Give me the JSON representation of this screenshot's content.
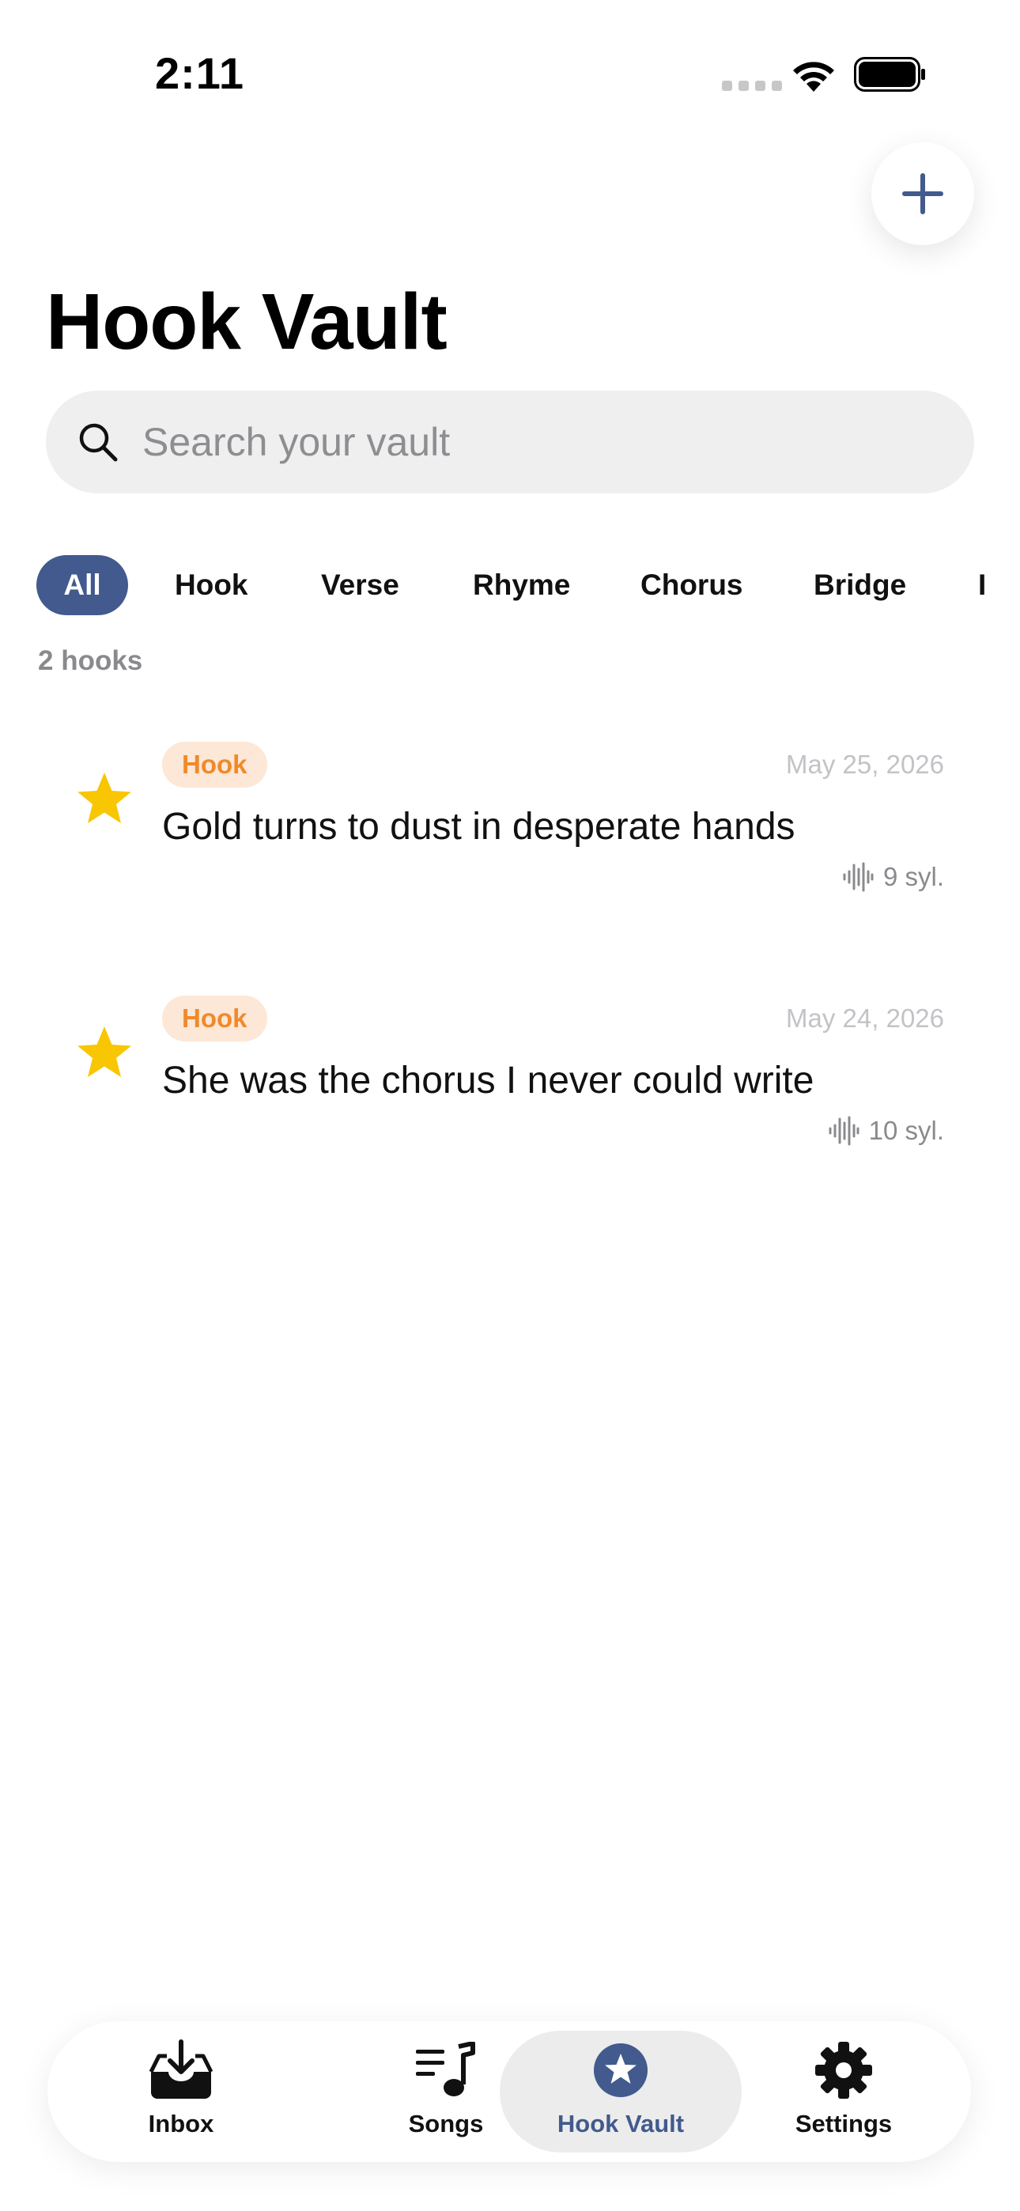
{
  "status_bar": {
    "time": "2:11"
  },
  "header": {
    "title": "Hook Vault",
    "add_icon": "plus-icon"
  },
  "search": {
    "placeholder": "Search your vault",
    "value": "",
    "icon": "search-icon"
  },
  "filters": {
    "selected": "All",
    "items": [
      "All",
      "Hook",
      "Verse",
      "Rhyme",
      "Chorus",
      "Bridge",
      "I"
    ]
  },
  "count_label": "2 hooks",
  "hooks": [
    {
      "starred": true,
      "type": "Hook",
      "date": "May 25, 2026",
      "text": "Gold turns to dust in desperate hands",
      "syllables": "9 syl."
    },
    {
      "starred": true,
      "type": "Hook",
      "date": "May 24, 2026",
      "text": "She was the chorus I never could write",
      "syllables": "10 syl."
    }
  ],
  "tab_bar": {
    "active": "Hook Vault",
    "tabs": [
      {
        "label": "Inbox",
        "icon": "inbox-icon"
      },
      {
        "label": "Songs",
        "icon": "music-list-icon"
      },
      {
        "label": "Hook Vault",
        "icon": "star-circle-icon"
      },
      {
        "label": "Settings",
        "icon": "gear-icon"
      }
    ]
  },
  "colors": {
    "accent": "#425a8d",
    "star": "#f8c602",
    "badge_bg": "#fde7d6",
    "badge_text": "#ef8a2b",
    "search_bg": "#efefef"
  }
}
